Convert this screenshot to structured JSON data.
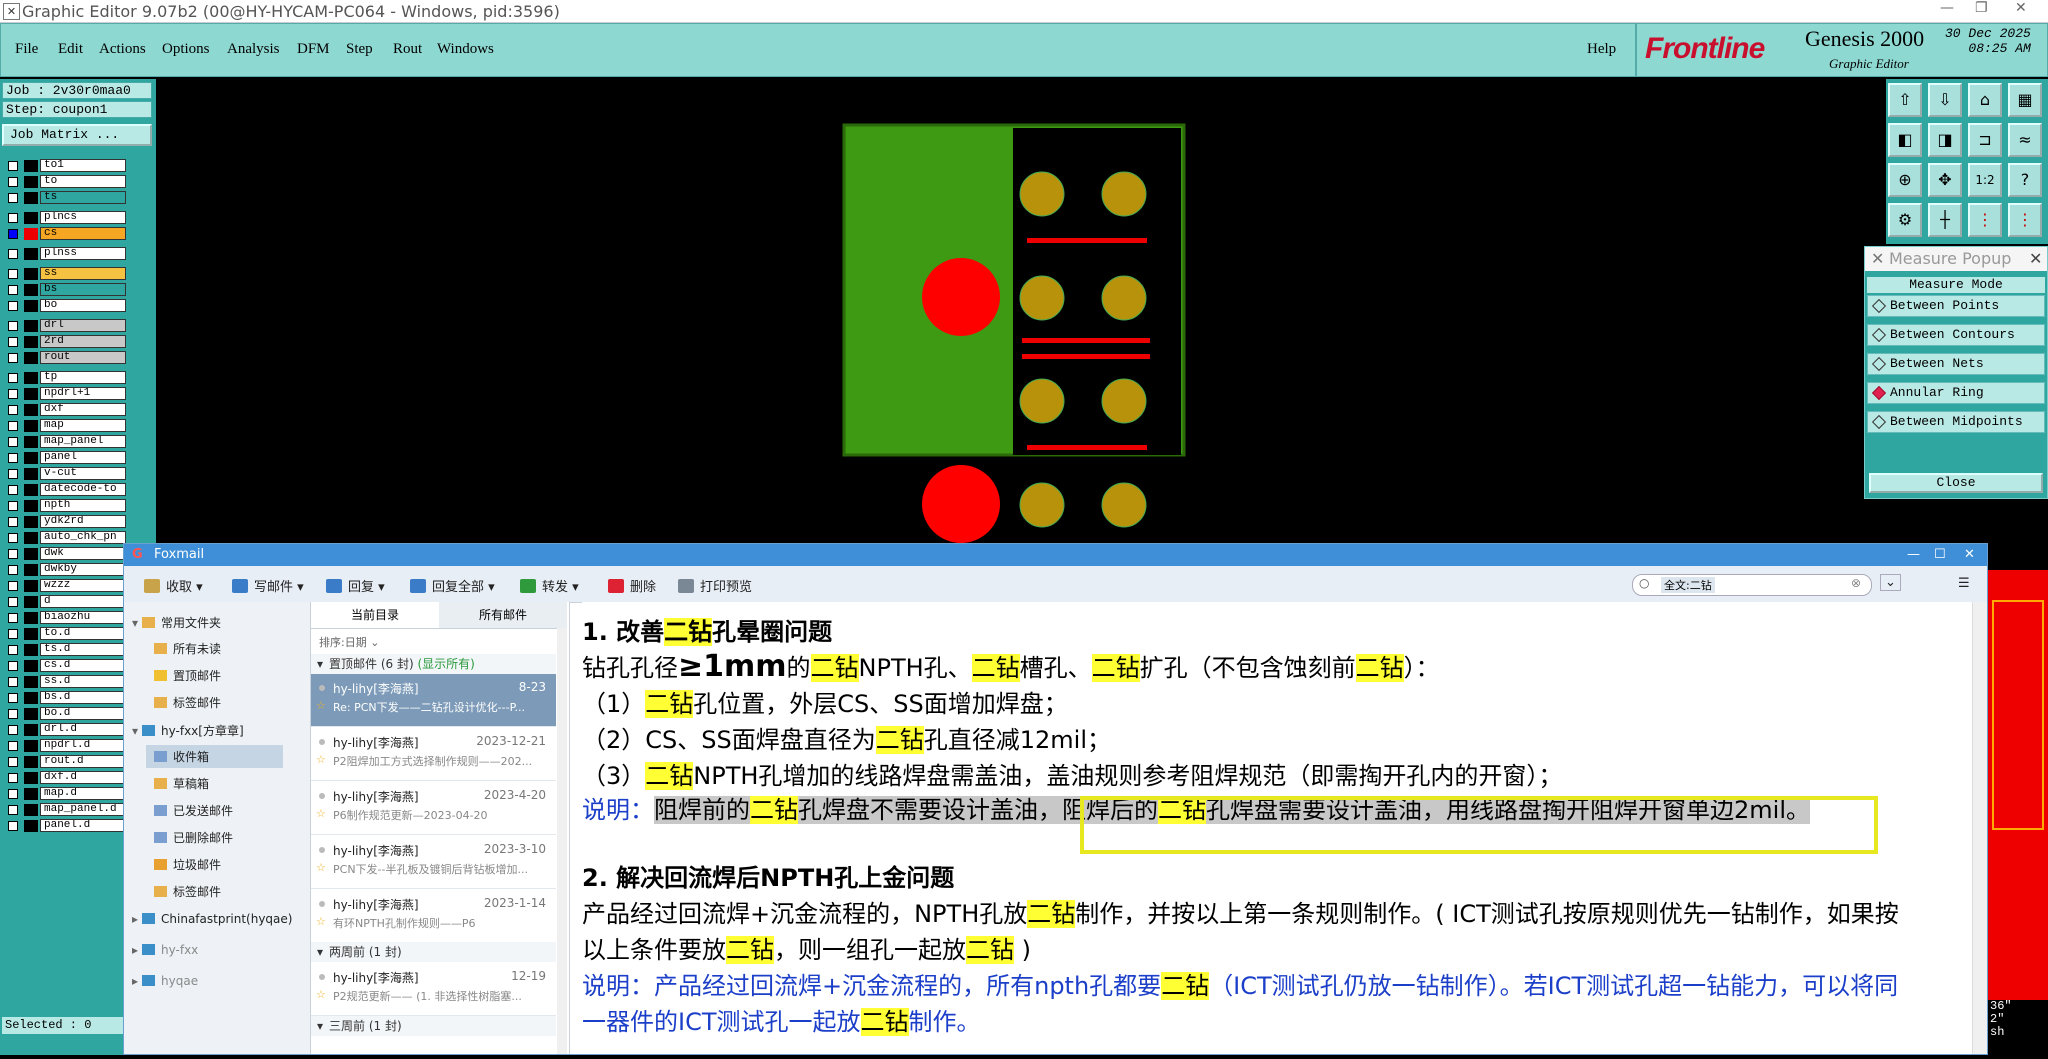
{
  "window": {
    "title": "Graphic Editor 9.07b2 (00@HY-HYCAM-PC064 - Windows, pid:3596)"
  },
  "menu": {
    "items": [
      "File",
      "Edit",
      "Actions",
      "Options",
      "Analysis",
      "DFM",
      "Step",
      "Rout",
      "Windows"
    ],
    "help": "Help"
  },
  "brand": {
    "logo": "Frontline",
    "product": "Genesis 2000",
    "subtitle": "Graphic Editor",
    "date": "30 Dec 2025",
    "time": "08:25 AM"
  },
  "job": {
    "job": "Job : 2v30r0maa0",
    "step": "Step: coupon1",
    "matrix_button": "Job Matrix ..."
  },
  "layers": [
    "to1",
    "to",
    "ts",
    "plncs",
    "cs",
    "plnss",
    "ss",
    "bs",
    "bo",
    "drl",
    "2rd",
    "rout",
    "tp",
    "npdrl+1",
    "dxf",
    "map",
    "map_panel",
    "panel",
    "v-cut",
    "datecode-to",
    "npth",
    "ydk2rd",
    "auto_chk_pn",
    "dwk",
    "dwkby",
    "wzzz",
    "d",
    "biaozhu",
    "to.d",
    "ts.d",
    "cs.d",
    "ss.d",
    "bs.d",
    "bo.d",
    "drl.d",
    "npdrl.d",
    "rout.d",
    "dxf.d",
    "map.d",
    "map_panel.d",
    "panel.d"
  ],
  "status": {
    "selected": "Selected : 0"
  },
  "measure": {
    "title": "Measure Popup",
    "mode": "Measure Mode",
    "options": [
      {
        "label": "Between Points",
        "on": false
      },
      {
        "label": "Between Contours",
        "on": false
      },
      {
        "label": "Between Nets",
        "on": false
      },
      {
        "label": "Annular Ring",
        "on": true
      },
      {
        "label": "Between Midpoints",
        "on": false
      }
    ],
    "close": "Close"
  },
  "tools": {
    "one_two": "1:2",
    "help": "?"
  },
  "canvas_side": {
    "t1": "36\"",
    "t2": "2\"",
    "t3": "sh"
  },
  "foxmail": {
    "title": "Foxmail",
    "toolbar": [
      "收取",
      "写邮件",
      "回复",
      "回复全部",
      "转发",
      "删除",
      "打印预览"
    ],
    "search": "全文:二钻",
    "folders": {
      "common": "常用文件夹",
      "common_items": [
        "所有未读",
        "置顶邮件",
        "标签邮件"
      ],
      "account": "hy-fxx[方章章]",
      "account_items": [
        "收件箱",
        "草稿箱",
        "已发送邮件",
        "已删除邮件",
        "垃圾邮件",
        "标签邮件"
      ],
      "others": [
        "Chinafastprint(hyqae)",
        "hy-fxx",
        "hyqae"
      ]
    },
    "list": {
      "tabs": [
        "当前目录",
        "所有邮件"
      ],
      "sort": "排序:日期",
      "group1": "置顶邮件 (6 封)",
      "show_all": "(显示所有)",
      "group2": "两周前 (1 封)",
      "group3": "三周前 (1 封)",
      "rows": [
        {
          "from": "hy-lihy[李海燕]",
          "date": "8-23",
          "subject": "Re: PCN下发——二钻孔设计优化---P..."
        },
        {
          "from": "hy-lihy[李海燕]",
          "date": "2023-12-21",
          "subject": "P2阻焊加工方式选择制作规则——202..."
        },
        {
          "from": "hy-lihy[李海燕]",
          "date": "2023-4-20",
          "subject": "P6制作规范更新—2023-04-20"
        },
        {
          "from": "hy-lihy[李海燕]",
          "date": "2023-3-10",
          "subject": "PCN下发--半孔板及镀铜后背钻板增加..."
        },
        {
          "from": "hy-lihy[李海燕]",
          "date": "2023-1-14",
          "subject": "有环NPTH孔制作规则——P6"
        },
        {
          "from": "hy-lihy[李海燕]",
          "date": "12-19",
          "subject": "P2规范更新—— (1. 非选择性树脂塞..."
        }
      ]
    },
    "body": {
      "s1_title_a": "1. 改善",
      "s1_title_hl": "二钻",
      "s1_title_b": "孔晕圈问题",
      "l1_a": "钻孔孔径",
      "l1_b": "≥1mm",
      "l1_c": "的",
      "l1_d": "NPTH孔、",
      "l1_e": "槽孔、",
      "l1_f": "扩孔（不包含蚀刻前",
      "l1_g": "）：",
      "hl": "二钻",
      "l2_a": "（1）",
      "l2_b": "孔位置，外层CS、SS面增加焊盘；",
      "l3_a": "（2）CS、SS面焊盘直径为",
      "l3_b": "孔直径减12mil；",
      "l4_a": "（3）",
      "l4_b": "NPTH孔增加的线路焊盘需盖油，盖油规则参考阻焊规范（即需掏开孔内的开窗）；",
      "n1_a": "说明：",
      "n1_b": "阻焊前的",
      "n1_c": "孔焊盘不需要设计盖油，阻焊后的",
      "n1_d": "孔焊盘需要设计盖油，用线路盘掏开阻焊开窗单边2mil。",
      "s2_title": "2. 解决回流焊后NPTH孔上金问题",
      "p1_a": "产品经过回流焊+沉金流程的，NPTH孔放",
      "p1_b": "制作，并按以上第一条规则制作。( ICT测试孔按原规则优先一钻制作，如果按",
      "p2_a": "以上条件要放",
      "p2_b": "，则一组孔一起放",
      "p2_c": " )",
      "n2_a": "说明：产品经过回流焊+沉金流程的，所有npth孔都要",
      "n2_b": "（ICT测试孔仍放一钻制作）。若ICT测试孔超一钻能力，可以将同",
      "n3_a": "一器件的ICT测试孔一起放",
      "n3_b": "制作。"
    }
  }
}
